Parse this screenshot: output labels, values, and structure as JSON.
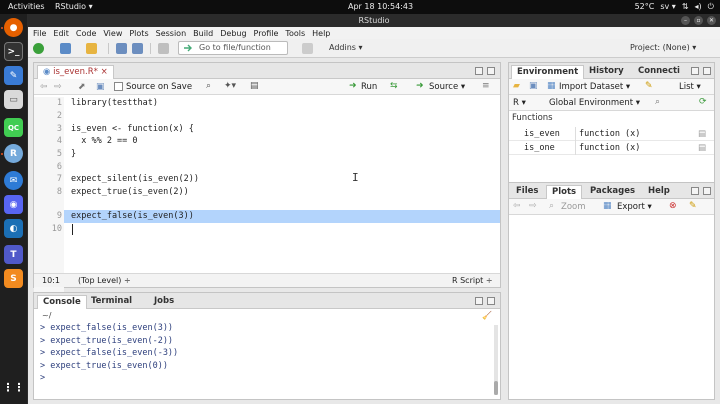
{
  "topbar": {
    "activities": "Activities",
    "app_menu": "RStudio ▾",
    "clock": "Apr 18  10:54:43",
    "temp": "52°C",
    "lang": "sv ▾"
  },
  "window": {
    "title": "RStudio"
  },
  "menu": [
    "File",
    "Edit",
    "Code",
    "View",
    "Plots",
    "Session",
    "Build",
    "Debug",
    "Profile",
    "Tools",
    "Help"
  ],
  "toolbar": {
    "goto_placeholder": "Go to file/function",
    "addins_label": "Addins ▾",
    "project_label": "Project: (None) ▾"
  },
  "editor": {
    "tab_label": "is_even.R*",
    "source_on_save_label": "Source on Save",
    "run_label": "Run",
    "source_label": "Source ▾",
    "lines": [
      {
        "n": "1",
        "text": "library(testthat)"
      },
      {
        "n": "2",
        "text": ""
      },
      {
        "n": "3",
        "text": "is_even <- function(x) {"
      },
      {
        "n": "4",
        "text": "  x %% 2 == 0"
      },
      {
        "n": "5",
        "text": "}"
      },
      {
        "n": "6",
        "text": ""
      },
      {
        "n": "7",
        "text": "expect_silent(is_even(2))"
      },
      {
        "n": "8",
        "text": "expect_true(is_even(2))"
      },
      {
        "n": "9",
        "text": "expect_false(is_even(3))"
      },
      {
        "n": "10",
        "text": ""
      }
    ],
    "status_pos": "10:1",
    "status_scope": "(Top Level) ÷",
    "status_type": "R Script ÷"
  },
  "console": {
    "tabs": [
      "Console",
      "Terminal",
      "Jobs"
    ],
    "path": "~/",
    "lines": [
      "> expect_false(is_even(3))",
      "> expect_true(is_even(-2))",
      "> expect_false(is_even(-3))",
      "> expect_true(is_even(0))",
      "> "
    ]
  },
  "environment": {
    "tabs": [
      "Environment",
      "History",
      "Connecti"
    ],
    "import_label": "Import Dataset ▾",
    "list_label": "List ▾",
    "lang_label": "R ▾",
    "scope_label": "Global Environment ▾",
    "section": "Functions",
    "rows": [
      {
        "name": "is_even",
        "value": "function (x)"
      },
      {
        "name": "is_one",
        "value": "function (x)"
      }
    ]
  },
  "files": {
    "tabs": [
      "Files",
      "Plots",
      "Packages",
      "Help"
    ],
    "zoom_label": "Zoom",
    "export_label": "Export ▾"
  },
  "colors": {
    "accent": "#5b8bc7",
    "selection": "#b3d4fc",
    "ubuntu_orange": "#e95420"
  }
}
